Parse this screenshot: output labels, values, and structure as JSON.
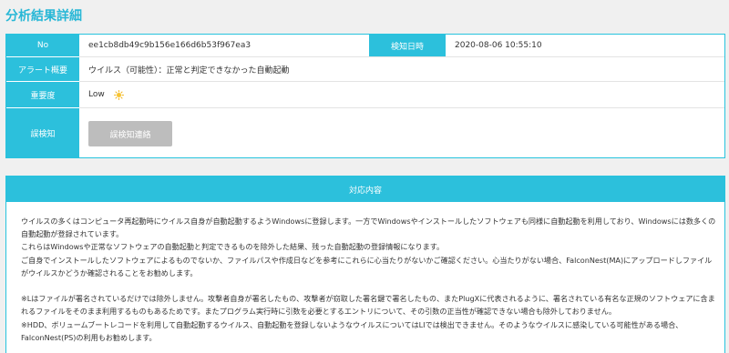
{
  "page": {
    "title": "分析結果詳細"
  },
  "detail": {
    "no_label": "No",
    "no_value": "ee1cb8db49c9b156e166d6b53f967ea3",
    "detected_label": "検知日時",
    "detected_value": "2020-08-06 10:55:10",
    "alert_label": "アラート概要",
    "alert_value": "ウイルス（可能性）：正常と判定できなかった自動起動",
    "severity_label": "重要度",
    "severity_value": "Low",
    "severity_icon": "sun-icon",
    "false_positive_label": "誤検知",
    "false_positive_button": "誤検知連絡"
  },
  "action": {
    "header": "対応内容",
    "paragraphs": [
      "ウイルスの多くはコンピュータ再起動時にウイルス自身が自動起動するようWindowsに登録します。一方でWindowsやインストールしたソフトウェアも同様に自動起動を利用しており、Windowsには数多くの自動起動が登録されています。",
      "これらはWindowsや正常なソフトウェアの自動起動と判定できるものを除外した結果、残った自動起動の登録情報になります。",
      "ご自身でインストールしたソフトウェアによるものでないか、ファイルパスや作成日などを参考にこれらに心当たりがないかご確認ください。心当たりがない場合、FalconNest(MA)にアップロードしファイルがウイルスかどうか確認されることをお勧めします。",
      "※Lはファイルが署名されているだけでは除外しません。攻撃者自身が署名したもの、攻撃者が窃取した署名鍵で署名したもの、またPlugXに代表されるように、署名されている有名な正規のソフトウェアに含まれるファイルをそのまま利用するものもあるためです。またプログラム実行時に引数を必要とするエントリについて、その引数の正当性が確認できない場合も除外しておりません。",
      "※HDD、ボリュームブートレコードを利用して自動起動するウイルス、自動起動を登録しないようなウイルスについてはLIでは検出できません。そのようなウイルスに感染している可能性がある場合、FalconNest(PS)の利用もお勧めします。"
    ]
  },
  "colors": {
    "accent": "#2cc0dc",
    "title": "#27b7d6",
    "button": "#bdbdbd",
    "background": "#f0f0f0"
  }
}
